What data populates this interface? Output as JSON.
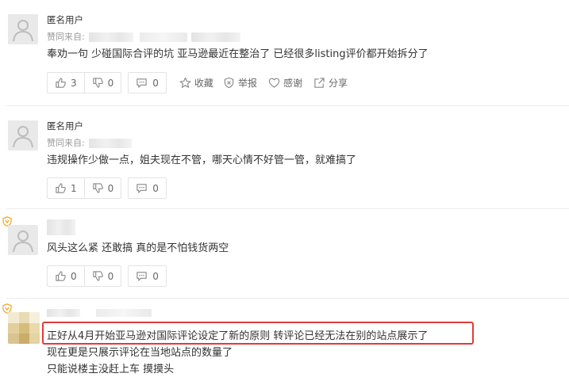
{
  "comments": [
    {
      "username": "匿名用户",
      "meta_label": "赞同来自:",
      "body": [
        "奉劝一句 少碰国际合评的坑 亚马逊最近在整治了 已经很多listing评价都开始拆分了"
      ],
      "likes": "3",
      "dislikes": "0",
      "replies": "0",
      "extra_actions": {
        "favorite": "收藏",
        "report": "举报",
        "thanks": "感谢",
        "share": "分享"
      }
    },
    {
      "username": "匿名用户",
      "meta_label": "赞同来自:",
      "body": [
        "违规操作少做一点，姐夫现在不管，哪天心情不好管一管，就难搞了"
      ],
      "likes": "1",
      "dislikes": "0",
      "replies": "0"
    },
    {
      "username": "",
      "body": [
        "风头这么紧 还敢搞  真的是不怕钱货两空"
      ],
      "likes": "0",
      "dislikes": "0",
      "replies": "0"
    },
    {
      "username": "",
      "body": [
        "正好从4月开始亚马逊对国际评论设定了新的原则 转评论已经无法在别的站点展示了",
        "现在更是只展示评论在当地站点的数量了",
        "只能说楼主没赶上车  摸摸头"
      ]
    }
  ],
  "colors": {
    "highlight": "#e23a3a",
    "badge": "#f2a31b",
    "muted": "#999999"
  },
  "icons": [
    "thumbs-up-icon",
    "thumbs-down-icon",
    "comment-icon",
    "star-icon",
    "report-icon",
    "heart-icon",
    "share-icon",
    "verified-badge-icon"
  ]
}
